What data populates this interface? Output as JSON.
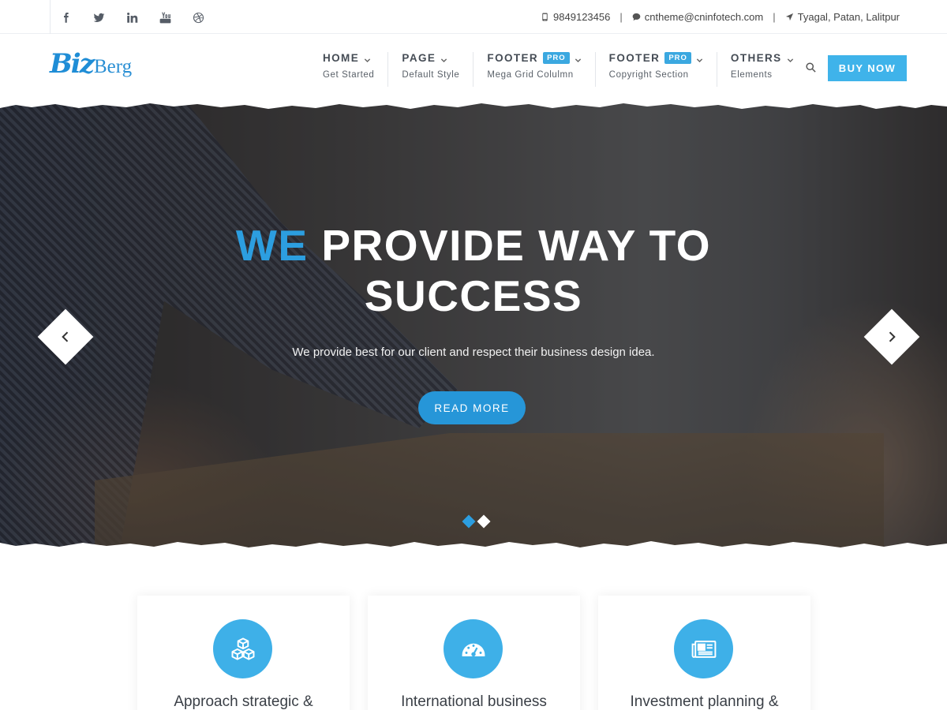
{
  "topbar": {
    "social": [
      {
        "icon": "facebook-icon"
      },
      {
        "icon": "twitter-icon"
      },
      {
        "icon": "linkedin-icon"
      },
      {
        "icon": "youtube-icon"
      },
      {
        "icon": "dribbble-icon"
      }
    ],
    "phone": "9849123456",
    "email": "cntheme@cninfotech.com",
    "location": "Tyagal, Patan, Lalitpur",
    "separator": "|"
  },
  "header": {
    "logo_mark": "Biz",
    "logo_text": "Berg",
    "nav": [
      {
        "label": "HOME",
        "sub": "Get Started",
        "badge": ""
      },
      {
        "label": "PAGE",
        "sub": "Default Style",
        "badge": ""
      },
      {
        "label": "FOOTER",
        "sub": "Mega Grid Colulmn",
        "badge": "PRO"
      },
      {
        "label": "FOOTER",
        "sub": "Copyright Section",
        "badge": "PRO"
      },
      {
        "label": "OTHERS",
        "sub": "Elements",
        "badge": ""
      }
    ],
    "buy_label": "BUY NOW",
    "accent_color": "#3fb3ea"
  },
  "hero": {
    "title_accent": "WE",
    "title_rest": "PROVIDE WAY TO",
    "title_line2": "SUCCESS",
    "description": "We provide best for our client and respect their business design idea.",
    "button_label": "READ MORE",
    "slides_total": 2,
    "slide_active": 1
  },
  "features": [
    {
      "title": "Approach strategic &",
      "icon": "cubes-icon"
    },
    {
      "title": "International business",
      "icon": "dashboard-icon"
    },
    {
      "title": "Investment planning &",
      "icon": "newspaper-icon"
    }
  ]
}
